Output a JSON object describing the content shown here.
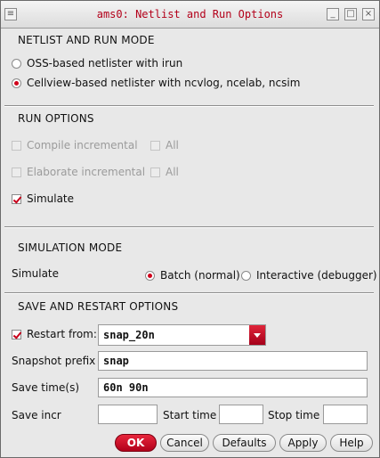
{
  "window": {
    "title": "ams0: Netlist and Run Options",
    "menu_glyph": "≡",
    "minimize_glyph": "_",
    "maximize_glyph": "□",
    "close_glyph": "×"
  },
  "netlist_section": {
    "title": "NETLIST AND RUN MODE",
    "options": [
      {
        "label": "OSS-based netlister with irun",
        "selected": false
      },
      {
        "label": "Cellview-based netlister with ncvlog, ncelab, ncsim",
        "selected": true
      }
    ]
  },
  "run_options": {
    "title": "RUN OPTIONS",
    "compile_incremental": "Compile incremental",
    "compile_all": "All",
    "elaborate_incremental": "Elaborate incremental",
    "elaborate_all": "All",
    "simulate": "Simulate",
    "simulate_checked": true
  },
  "simulation_mode": {
    "title": "SIMULATION MODE",
    "label": "Simulate",
    "batch": "Batch (normal)",
    "interactive": "Interactive (debugger)",
    "selected": "batch"
  },
  "save_restart": {
    "title": "SAVE AND RESTART OPTIONS",
    "restart_label": "Restart from:",
    "restart_checked": true,
    "restart_value": "snap_20n",
    "snapshot_prefix_label": "Snapshot prefix",
    "snapshot_prefix_value": "snap",
    "save_times_label": "Save time(s)",
    "save_times_value": "60n 90n",
    "save_incr_label": "Save incr",
    "save_incr_value": "",
    "start_time_label": "Start time",
    "start_time_value": "",
    "stop_time_label": "Stop time",
    "stop_time_value": ""
  },
  "buttons": {
    "ok": "OK",
    "cancel": "Cancel",
    "defaults": "Defaults",
    "apply": "Apply",
    "help": "Help"
  },
  "colors": {
    "accent": "#d0021b",
    "title_text": "#b3001a",
    "background": "#e8e8e8"
  }
}
